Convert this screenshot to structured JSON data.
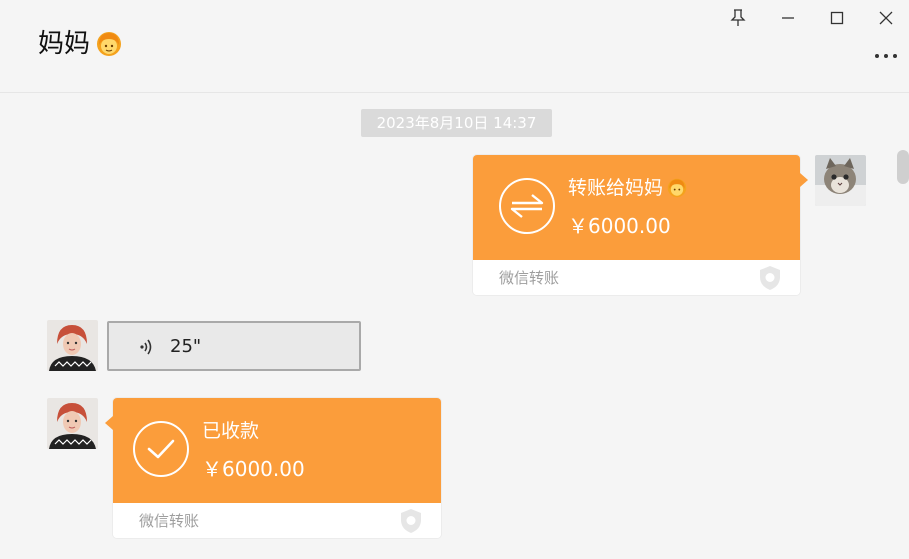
{
  "header": {
    "contact_name": "妈妈",
    "contact_emoji": "woman-face-emoji"
  },
  "window_controls": [
    "pin-icon",
    "minimize-icon",
    "maximize-icon",
    "close-icon"
  ],
  "more_icon": "more-dots-icon",
  "timestamp": "2023年8月10日 14:37",
  "messages": [
    {
      "type": "transfer",
      "direction": "outgoing",
      "title": "转账给妈妈",
      "amount": "￥6000.00",
      "footer": "微信转账",
      "icon": "transfer-arrows-icon"
    },
    {
      "type": "voice",
      "direction": "incoming",
      "duration": "25\""
    },
    {
      "type": "transfer",
      "direction": "incoming",
      "title": "已收款",
      "amount": "￥6000.00",
      "footer": "微信转账",
      "icon": "check-icon"
    }
  ],
  "colors": {
    "transfer_orange": "#fb9d3b",
    "background": "#f5f5f5",
    "timestamp_bg": "#dadada",
    "footer_text": "#9e9e9e"
  }
}
